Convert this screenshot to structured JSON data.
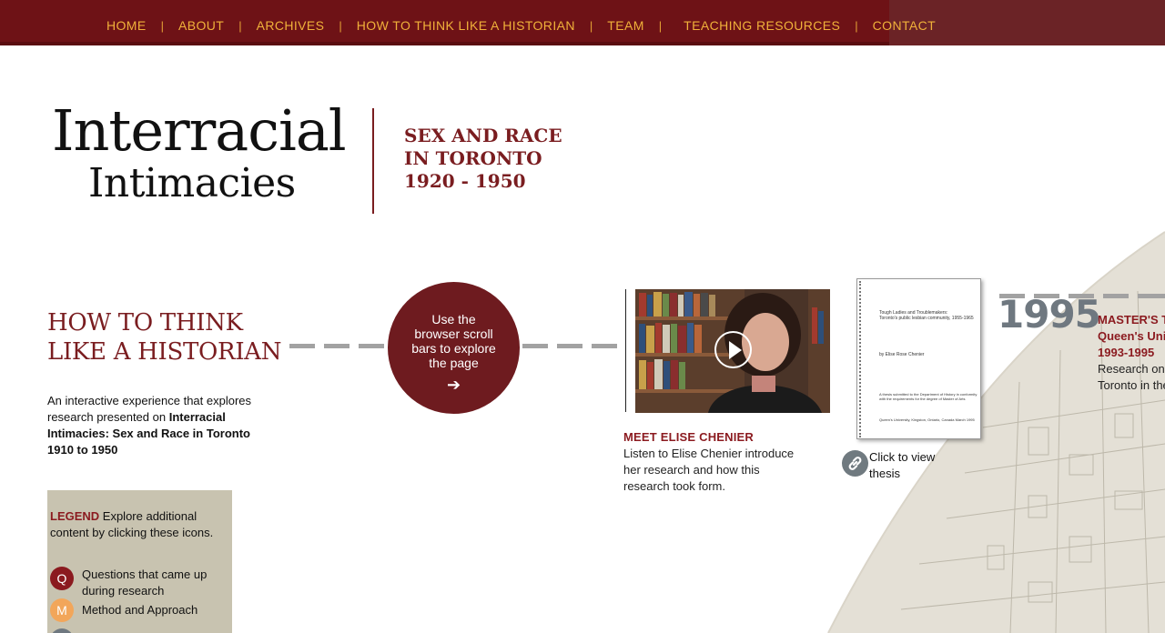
{
  "nav": {
    "items": [
      "HOME",
      "ABOUT",
      "ARCHIVES",
      "HOW TO THINK LIKE A HISTORIAN",
      "TEAM",
      "TEACHING RESOURCES",
      "CONTACT"
    ],
    "separator": "|"
  },
  "header": {
    "title_line1": "Interracial",
    "title_line2": "Intimacies",
    "subtitle_line1": "SEX AND RACE",
    "subtitle_line2": "IN TORONTO",
    "subtitle_line3": "1920 - 1950"
  },
  "intro": {
    "heading_line1": "HOW TO THINK",
    "heading_line2": "LIKE A HISTORIAN",
    "text_plain": "An interactive experience that explores research presented on ",
    "text_bold": "Interracial Intimacies: Sex and Race in Toronto 1910 to 1950"
  },
  "legend": {
    "label": "LEGEND",
    "text": " Explore additional content by clicking these icons.",
    "items": [
      {
        "letter": "Q",
        "label": "Questions that came up during research",
        "color": "#8b1a1f"
      },
      {
        "letter": "M",
        "label": "Method and Approach",
        "color": "#f2a65a"
      },
      {
        "letter": "",
        "label": "",
        "color": "#6f7880"
      }
    ]
  },
  "scroll_hint": {
    "line1": "Use the",
    "line2": "browser scroll",
    "line3": "bars to explore",
    "line4": "the page",
    "arrow": "➔"
  },
  "video": {
    "title": "MEET ELISE CHENIER",
    "description": "Listen to Elise Chenier introduce her research and how this research took form."
  },
  "thesis": {
    "doc_title": "Tough Ladies and Troublemakers:",
    "doc_subtitle": "Toronto's public lesbian community, 1955-1965",
    "doc_author": "by Elise Rose Chenier",
    "doc_statement": "A thesis submitted to the Department of History in conformity with the requirements for the degree of Master of Arts",
    "doc_place": "Queen's University, Kingston, Ontario, Canada March 1995",
    "link_text": "Click to view thesis"
  },
  "timeline_1995": {
    "year": "1995",
    "title_line1": "MASTER'S T",
    "title_line2": "Queen's Uni",
    "title_line3": "1993-1995",
    "desc_line1": "Research on",
    "desc_line2": "Toronto in the"
  },
  "colors": {
    "nav_bg": "#6e1216",
    "nav_text": "#f0b13a",
    "accent": "#7a1d20",
    "legend_bg": "#c8c3b0",
    "year_gray": "#6f7880"
  }
}
